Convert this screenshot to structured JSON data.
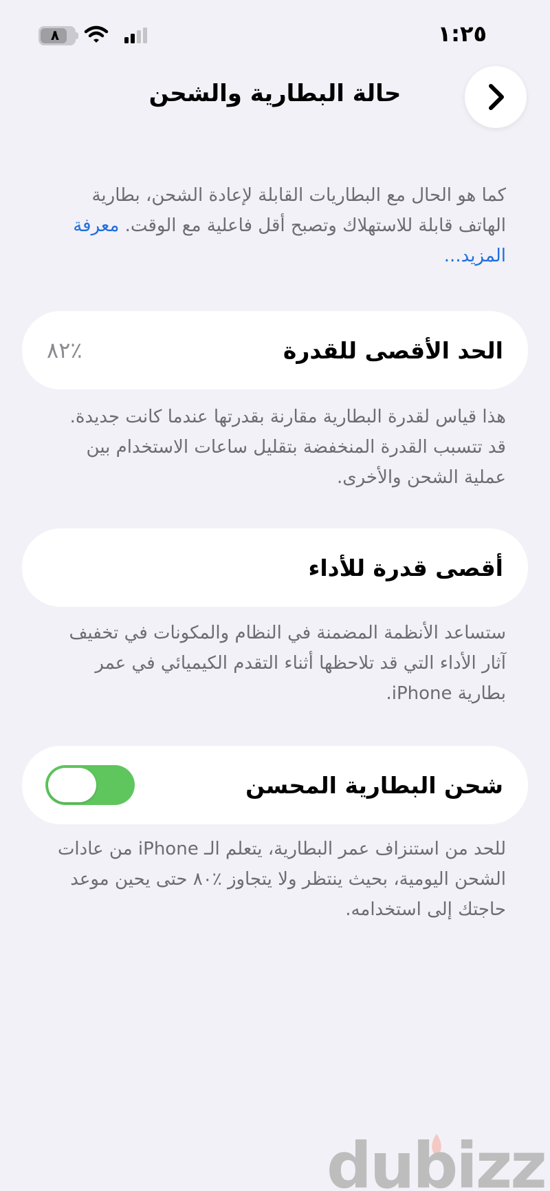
{
  "status_bar": {
    "time": "١:٢٥",
    "battery_level_text": "٨",
    "battery_fraction": 0.8,
    "icons": [
      "battery-icon",
      "wifi-icon",
      "cellular-signal-icon"
    ]
  },
  "header": {
    "title": "حالة البطارية والشحن",
    "back_icon": "chevron-icon"
  },
  "intro": {
    "text": "كما هو الحال مع البطاريات القابلة لإعادة الشحن، بطارية الهاتف قابلة للاستهلاك وتصبح أقل فاعلية مع الوقت.",
    "learn_more": "معرفة المزيد..."
  },
  "max_capacity": {
    "label": "الحد الأقصى للقدرة",
    "value": "٪٨٢",
    "description": "هذا قياس لقدرة البطارية مقارنة بقدرتها عندما كانت جديدة. قد تتسبب القدرة المنخفضة بتقليل ساعات الاستخدام بين عملية الشحن والأخرى."
  },
  "peak_performance": {
    "label": "أقصى قدرة للأداء",
    "description": "ستساعد الأنظمة المضمنة في النظام والمكونات في تخفيف آثار الأداء التي قد تلاحظها أثناء التقدم الكيميائي في عمر بطارية iPhone."
  },
  "optimized_charging": {
    "label": "شحن البطارية المحسن",
    "enabled": true,
    "toggle_color": "#5fc65d",
    "description": "للحد من استنزاف عمر البطارية، يتعلم الـ iPhone من عادات الشحن اليومية، بحيث ينتظر ولا يتجاوز ٪٨٠ حتى يحين موعد حاجتك إلى استخدامه."
  },
  "watermark": {
    "text": "dubizzle"
  },
  "colors": {
    "background": "#f2f1f7",
    "link": "#1f6fde",
    "secondary_text": "#6c6c71"
  }
}
